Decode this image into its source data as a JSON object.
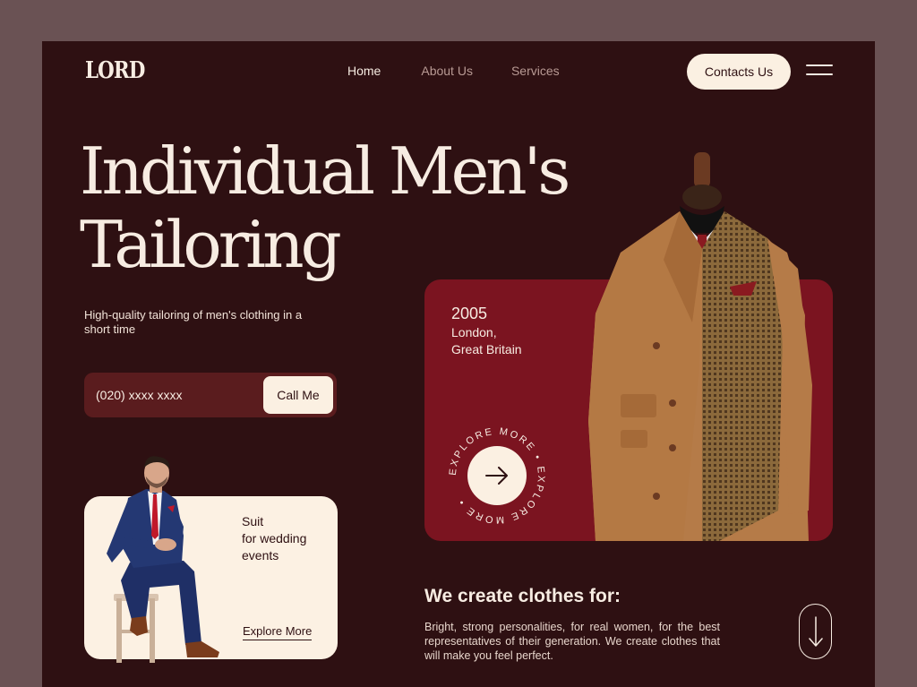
{
  "brand": {
    "logo": "LORD"
  },
  "nav": {
    "items": [
      "Home",
      "About Us",
      "Services"
    ],
    "active": 0
  },
  "header": {
    "contact_label": "Contacts Us"
  },
  "hero": {
    "title_line1": "Individual Men's",
    "title_line2": "Tailoring",
    "subtitle": "High-quality tailoring of men's clothing in a short time"
  },
  "phone": {
    "value": "(020) xxxx xxxx",
    "button_label": "Call Me"
  },
  "suit_card": {
    "line1": "Suit",
    "line2": "for wedding",
    "line3": "events",
    "link_label": "Explore More"
  },
  "feature": {
    "year": "2005",
    "place_line1": "London,",
    "place_line2": "Great Britain",
    "circle_text": "EXPLORE MORE • EXPLORE MORE •"
  },
  "create": {
    "title": "We create clothes for:",
    "description": "Bright, strong personalities, for real women, for the best representatives of their generation. We create clothes that will make you feel perfect."
  },
  "colors": {
    "background": "#6a5254",
    "frame": "#2e1012",
    "accent_red": "#7b1420",
    "cream": "#fbf0e2"
  },
  "icons": [
    "hamburger-menu-icon",
    "arrow-right-icon",
    "arrow-down-icon"
  ]
}
